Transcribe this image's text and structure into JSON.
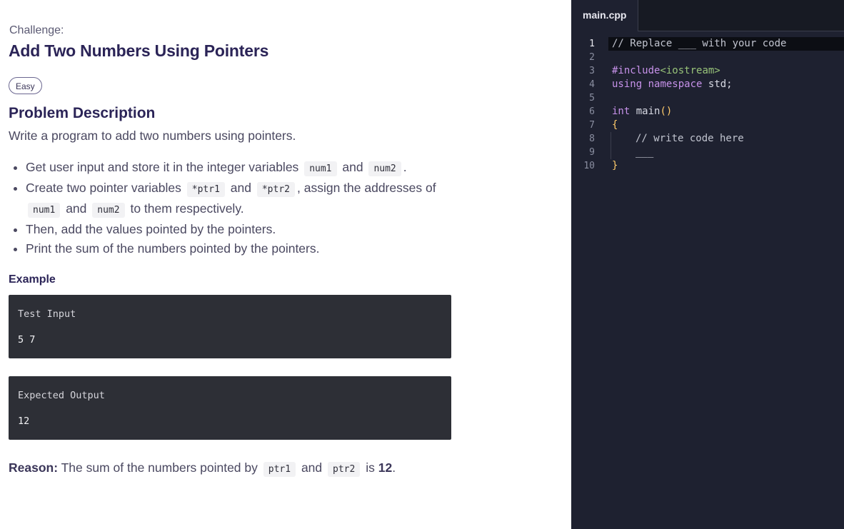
{
  "challenge": {
    "label": "Challenge:",
    "title": "Add Two Numbers Using Pointers",
    "difficulty": "Easy"
  },
  "problem": {
    "heading": "Problem Description",
    "description": "Write a program to add two numbers using pointers.",
    "bullets": {
      "b1_text1": "Get user input and store it in the integer variables",
      "b1_code1": "num1",
      "b1_and": "and",
      "b1_code2": "num2",
      "b1_end": ".",
      "b2_text1": "Create two pointer variables",
      "b2_code1": "*ptr1",
      "b2_and": "and",
      "b2_code2": "*ptr2",
      "b2_text2": ", assign the addresses of",
      "b2_code3": "num1",
      "b2_and2": "and",
      "b2_code4": "num2",
      "b2_text3": "to them respectively.",
      "b3": "Then, add the values pointed by the pointers.",
      "b4": "Print the sum of the numbers pointed by the pointers."
    }
  },
  "example": {
    "heading": "Example",
    "test_input_label": "Test Input",
    "test_input_value": "5 7",
    "expected_output_label": "Expected Output",
    "expected_output_value": "12"
  },
  "reason": {
    "label": "Reason:",
    "text1": "The sum of the numbers pointed by",
    "code1": "ptr1",
    "and": "and",
    "code2": "ptr2",
    "text2": "is",
    "value": "12",
    "end": "."
  },
  "editor": {
    "tab_name": "main.cpp",
    "line_numbers": [
      "1",
      "2",
      "3",
      "4",
      "5",
      "6",
      "7",
      "8",
      "9",
      "10"
    ],
    "l1": "// Replace ___ with your code",
    "l3_a": "#include",
    "l3_b": "<iostream>",
    "l4_a": "using",
    "l4_b": "namespace",
    "l4_c": "std;",
    "l6_a": "int",
    "l6_b": "main",
    "l6_c": "()",
    "l7": "{",
    "l8": "// write code here",
    "l9": "___",
    "l10": "}"
  },
  "colors": {
    "title": "#2b2457",
    "editor_bg": "#1e2130",
    "keyword": "#c792ea",
    "string": "#98c379",
    "bracket": "#ffcb6b"
  }
}
